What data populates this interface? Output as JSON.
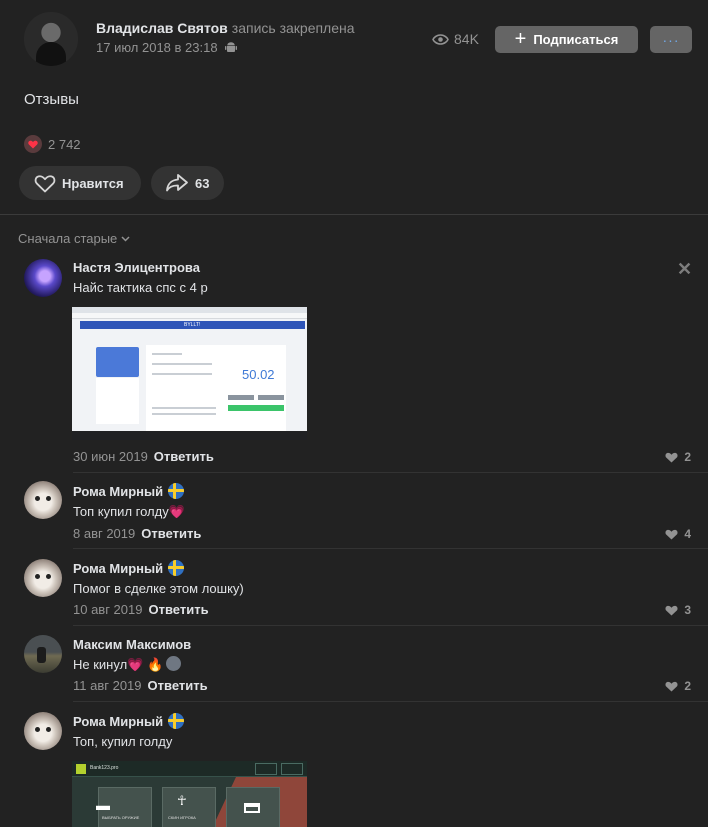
{
  "post": {
    "author": "Владислав Святов",
    "pinned_note": "запись закреплена",
    "date": "17 июл 2018 в 23:18",
    "views": "84K",
    "subscribe_label": "Подписаться",
    "more_label": "···",
    "text": "Отзывы",
    "reactions_count": "2 742",
    "like_label": "Нравится",
    "share_count": "63"
  },
  "comments_header": {
    "sort_label": "Сначала старые"
  },
  "comments": [
    {
      "name": "Настя Элицентрова",
      "text": "Найс тактика спс с 4 р",
      "date": "30 июн 2019",
      "reply": "Ответить",
      "likes": "2",
      "attachment": {
        "banner_text": "BYLLT!",
        "balance": "50.02"
      }
    },
    {
      "name": "Рома Мирный",
      "text": "Топ купил голду",
      "date": "8 авг 2019",
      "reply": "Ответить",
      "likes": "4"
    },
    {
      "name": "Рома Мирный",
      "text": "Помог в сделке этом лошку)",
      "date": "10 авг 2019",
      "reply": "Ответить",
      "likes": "3"
    },
    {
      "name": "Максим Максимов",
      "text": "Не кинул",
      "date": "11 авг 2019",
      "reply": "Ответить",
      "likes": "2"
    },
    {
      "name": "Рома Мирный",
      "text": "Топ, купил голду",
      "attachment": {
        "site": "Bank123.pro",
        "card1": "ВЫБРАТЬ ОРУЖИЕ",
        "card2": "СКИН ИГРОКА"
      }
    }
  ],
  "colors": {
    "background": "#222222",
    "button": "#656565",
    "text": "#e1e3e6",
    "muted": "#939393",
    "accent_heart": "#ff4fa3"
  },
  "icons": {
    "views": "eye-icon",
    "platform": "android-icon",
    "like": "heart-outline-icon",
    "share": "share-arrow-icon",
    "comment_like": "heart-icon",
    "close": "close-icon"
  }
}
